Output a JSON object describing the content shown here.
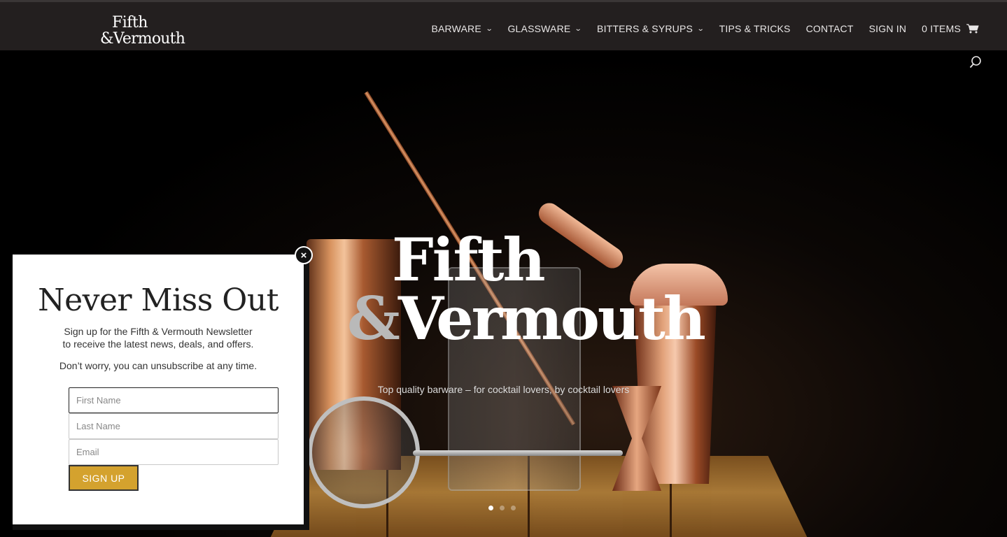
{
  "header": {
    "logo_line1": "Fifth",
    "logo_line2": "&Vermouth",
    "nav": [
      {
        "label": "BARWARE",
        "dropdown": true
      },
      {
        "label": "GLASSWARE",
        "dropdown": true
      },
      {
        "label": "BITTERS & SYRUPS",
        "dropdown": true
      },
      {
        "label": "TIPS & TRICKS",
        "dropdown": false
      },
      {
        "label": "CONTACT",
        "dropdown": false
      },
      {
        "label": "SIGN IN",
        "dropdown": false
      }
    ],
    "cart_label": "0 ITEMS",
    "icons": {
      "cart": "cart-icon",
      "search": "search-icon",
      "dropdown": "chevron-down-icon"
    }
  },
  "hero": {
    "title_line1": "Fifth",
    "title_amp": "&",
    "title_line2": "Vermouth",
    "subtitle": "Top quality barware – for cocktail lovers, by cocktail lovers",
    "slides": 3,
    "active_slide": 1
  },
  "popup": {
    "title": "Never Miss Out",
    "text_line1": "Sign up for the Fifth & Vermouth Newsletter",
    "text_line2": "to receive the latest news, deals, and offers.",
    "text_line3": "Don’t worry, you can unsubscribe at any time.",
    "first_name_placeholder": "First Name",
    "last_name_placeholder": "Last Name",
    "email_placeholder": "Email",
    "button_label": "SIGN UP",
    "close_symbol": "×",
    "button_color": "#d4a22e"
  }
}
